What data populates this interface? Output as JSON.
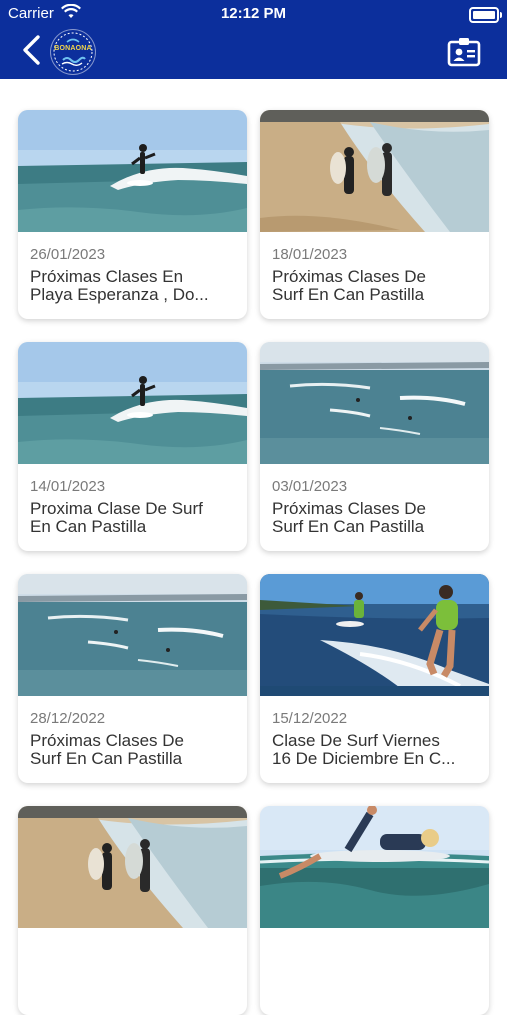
{
  "status_bar": {
    "carrier": "Carrier",
    "time": "12:12 PM"
  },
  "header": {
    "back_icon": "chevron-left-icon",
    "logo_text": "BONAONA",
    "action_icon": "contact-card-icon"
  },
  "posts": [
    {
      "date": "26/01/2023",
      "title_line1": "Próximas Clases En",
      "title_line2": "Playa Esperanza , Do...",
      "image": "surfer-riding-wave"
    },
    {
      "date": "18/01/2023",
      "title_line1": "Próximas Clases De",
      "title_line2": "Surf En Can Pastilla",
      "image": "surfers-walking-beach"
    },
    {
      "date": "14/01/2023",
      "title_line1": "Proxima Clase De Surf",
      "title_line2": "En Can Pastilla",
      "image": "surfer-riding-wave"
    },
    {
      "date": "03/01/2023",
      "title_line1": "Próximas Clases De",
      "title_line2": "Surf En Can Pastilla",
      "image": "ocean-waves-surfers"
    },
    {
      "date": "28/12/2022",
      "title_line1": "Próximas Clases De",
      "title_line2": "Surf En Can Pastilla",
      "image": "ocean-waves-surfers"
    },
    {
      "date": "15/12/2022",
      "title_line1": "Clase De Surf Viernes",
      "title_line2": "16 De Diciembre En C...",
      "image": "surfer-girl-on-board"
    },
    {
      "date": "",
      "title_line1": "",
      "title_line2": "",
      "image": "surfers-walking-beach"
    },
    {
      "date": "",
      "title_line1": "",
      "title_line2": "",
      "image": "surfer-underwater-view"
    }
  ]
}
